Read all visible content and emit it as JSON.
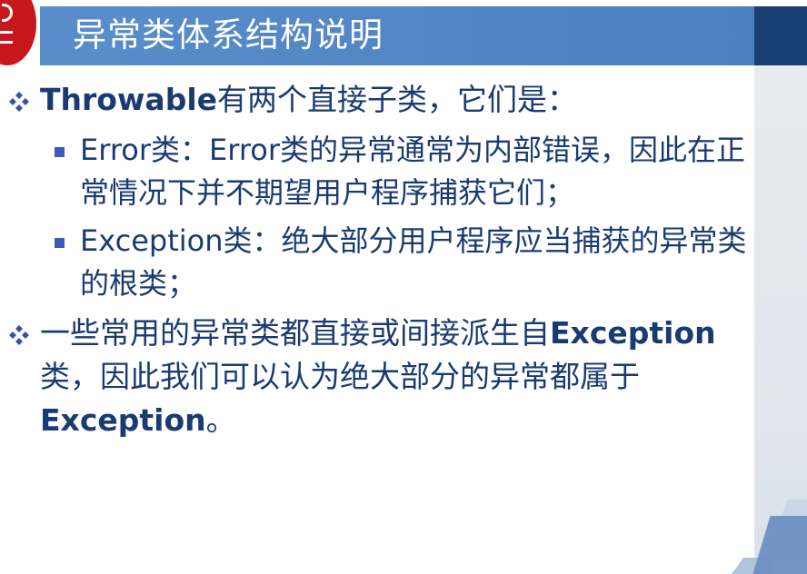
{
  "slide": {
    "title": "异常类体系结构说明",
    "colors": {
      "title_bar": "#5a8dcb",
      "title_dark_block": "#173f72",
      "text": "#1a3b72",
      "bullet_square": "#3a5bb9",
      "logo_red": "#c8161d"
    },
    "logo_icon": "university-seal-icon",
    "bullets": [
      {
        "level": 1,
        "bold": "Throwable",
        "text": "有两个直接子类，它们是："
      },
      {
        "level": 2,
        "text": "Error类：Error类的异常通常为内部错误，因此在正常情况下并不期望用户程序捕获它们；"
      },
      {
        "level": 2,
        "text": "Exception类：绝大部分用户程序应当捕获的异常类的根类；"
      },
      {
        "level": 1,
        "text_before": "一些常用的异常类都直接或间接派生自",
        "bold_1": "Exception",
        "text_middle": "类，因此我们可以认为绝大部分的异常都属于",
        "bold_2": "Exception",
        "text_after": "。"
      }
    ]
  }
}
